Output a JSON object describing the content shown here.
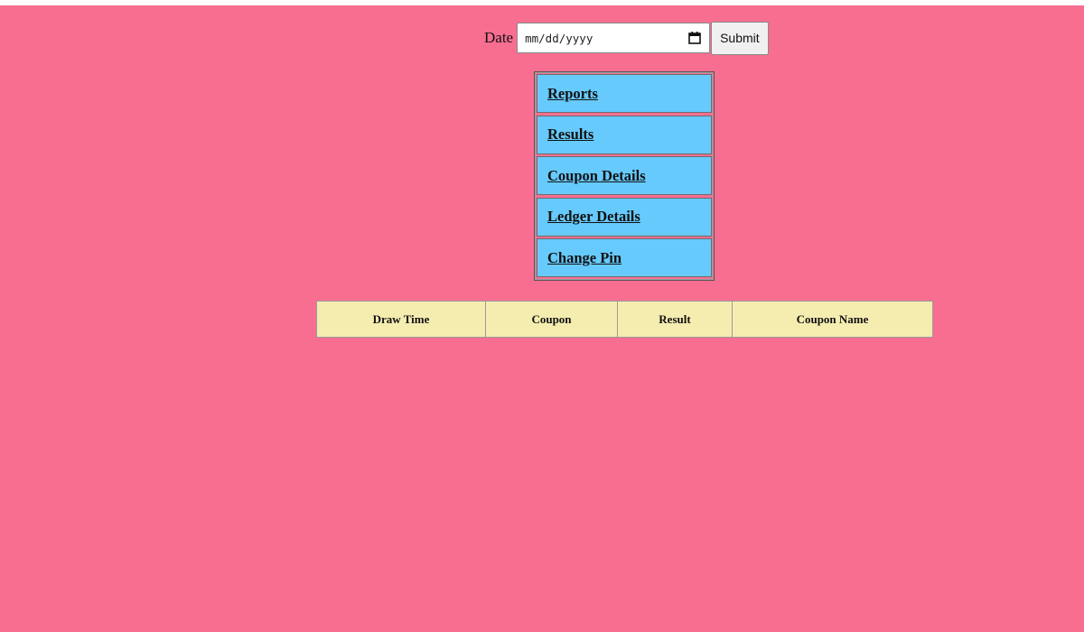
{
  "form": {
    "date_label": "Date",
    "date_placeholder": "mm/dd/yyyy",
    "submit_label": "Submit"
  },
  "menu": {
    "items": [
      {
        "label": "Reports"
      },
      {
        "label": "Results"
      },
      {
        "label": "Coupon Details"
      },
      {
        "label": "Ledger Details"
      },
      {
        "label": "Change Pin"
      }
    ]
  },
  "table": {
    "headers": [
      "Draw Time",
      "Coupon",
      "Result",
      "Coupon Name"
    ]
  },
  "colors": {
    "background": "#f76e91",
    "menu_item": "#67cafd",
    "table_header": "#f5edb0"
  },
  "icons": {
    "date_picker": "calendar-icon"
  }
}
